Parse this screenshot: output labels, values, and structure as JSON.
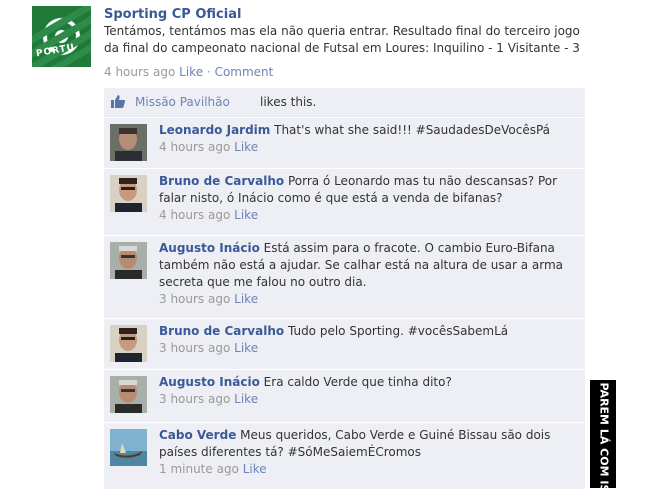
{
  "post": {
    "author": "Sporting CP Oficial",
    "text": "Tentámos, tentámos mas ela não queria entrar. Resultado final do terceiro jogo da final do campeonato nacional de Futsal em Loures: Inquilino - 1 Visitante - 3",
    "time": "4 hours ago",
    "like_label": "Like",
    "separator": "·",
    "comment_label": "Comment",
    "avatar_text": "PORTU"
  },
  "likes": {
    "liker": "Missão Pavilhão",
    "text": "likes this."
  },
  "comments": [
    {
      "name": "Leonardo Jardim",
      "text": "That's what she said!!! #SaudadesDeVocêsPá",
      "time": "4 hours ago",
      "like": "Like"
    },
    {
      "name": "Bruno de Carvalho",
      "text": "Porra ó Leonardo mas tu não descansas? Por falar nisto, ó Inácio como é que está a venda de bifanas?",
      "time": "4 hours ago",
      "like": "Like"
    },
    {
      "name": "Augusto Inácio",
      "text": "Está assim para o fracote. O cambio Euro-Bifana também não está a ajudar. Se calhar está na altura de usar a arma secreta que me falou no outro dia.",
      "time": "3 hours ago",
      "like": "Like"
    },
    {
      "name": "Bruno de Carvalho",
      "text": "Tudo pelo Sporting. #vocêsSabemLá",
      "time": "3 hours ago",
      "like": "Like"
    },
    {
      "name": "Augusto Inácio",
      "text": "Era caldo Verde que tinha dito?",
      "time": "3 hours ago",
      "like": "Like"
    },
    {
      "name": "Cabo Verde",
      "text": "Meus queridos, Cabo Verde e Guiné Bissau são dois países diferentes tá? #SóMeSaiemÉCromos",
      "time": "1 minute ago",
      "like": "Like"
    }
  ],
  "watermark": "PAREM LÁ COM ISSO",
  "colors": {
    "link": "#3b5998",
    "meta_link": "#6d84b4",
    "comment_bg": "#edeff4",
    "meta_text": "#999999"
  }
}
